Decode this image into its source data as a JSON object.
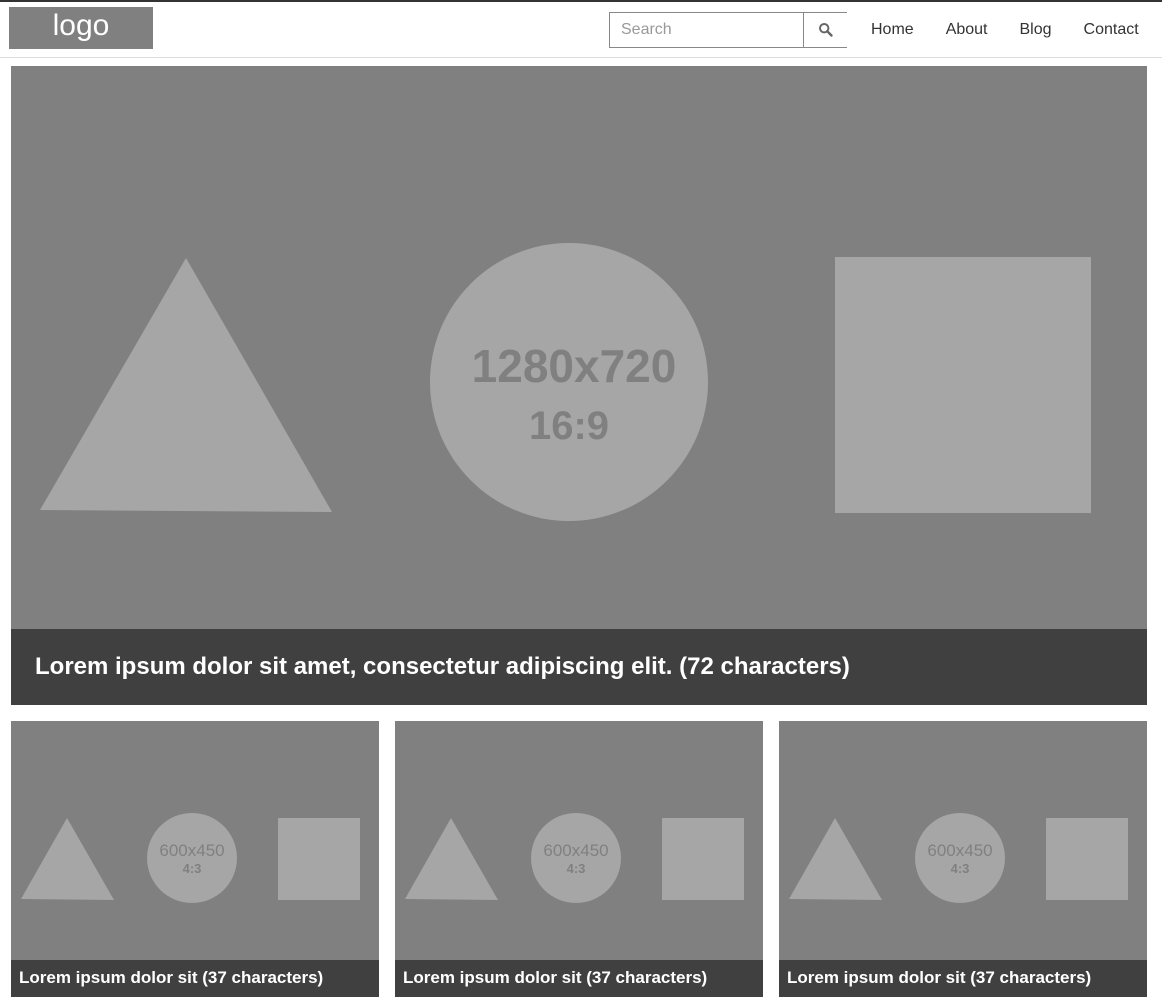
{
  "header": {
    "logo": "logo",
    "search": {
      "placeholder": "Search",
      "value": ""
    },
    "nav": [
      "Home",
      "About",
      "Blog",
      "Contact"
    ]
  },
  "hero": {
    "placeholder_size": "1280x720",
    "placeholder_ratio": "16:9",
    "caption": "Lorem ipsum dolor sit amet, consectetur adipiscing elit. (72 characters)"
  },
  "cards": [
    {
      "placeholder_size": "600x450",
      "placeholder_ratio": "4:3",
      "caption": "Lorem ipsum dolor sit (37 characters)"
    },
    {
      "placeholder_size": "600x450",
      "placeholder_ratio": "4:3",
      "caption": "Lorem ipsum dolor sit (37 characters)"
    },
    {
      "placeholder_size": "600x450",
      "placeholder_ratio": "4:3",
      "caption": "Lorem ipsum dolor sit (37 characters)"
    }
  ],
  "colors": {
    "placeholder_bg": "#808080",
    "placeholder_shape": "#a6a6a6",
    "caption_bg": "#404040"
  },
  "icons": {
    "search_button": "search-icon"
  }
}
